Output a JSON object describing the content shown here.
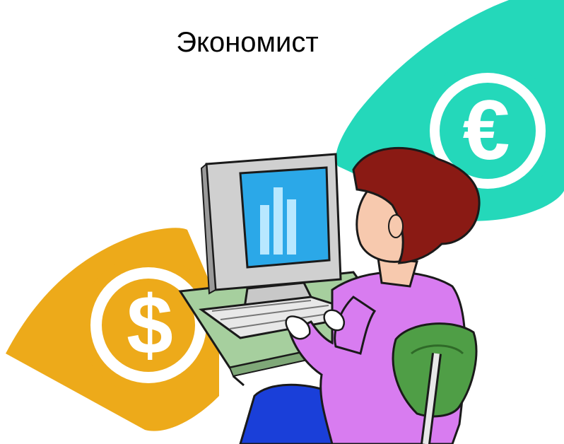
{
  "title": "Экономист",
  "symbols": {
    "euro": "€",
    "dollar": "$"
  },
  "icons": [
    "euro-icon",
    "dollar-icon",
    "computer-monitor-icon",
    "bar-chart-icon",
    "keyboard-icon",
    "woman-figure",
    "chair-icon",
    "desk-icon"
  ],
  "colors": {
    "euro": "#24D8BA",
    "dollar": "#EDAA1A",
    "desk": "#A6CF9E",
    "shirt": "#D87CF0",
    "hair": "#8A1A14",
    "skin": "#F7C9AE",
    "chair": "#4F9E46",
    "screen": "#2BA8E8",
    "bars": "#B8E8FF",
    "pants": "#1A3FD9"
  }
}
